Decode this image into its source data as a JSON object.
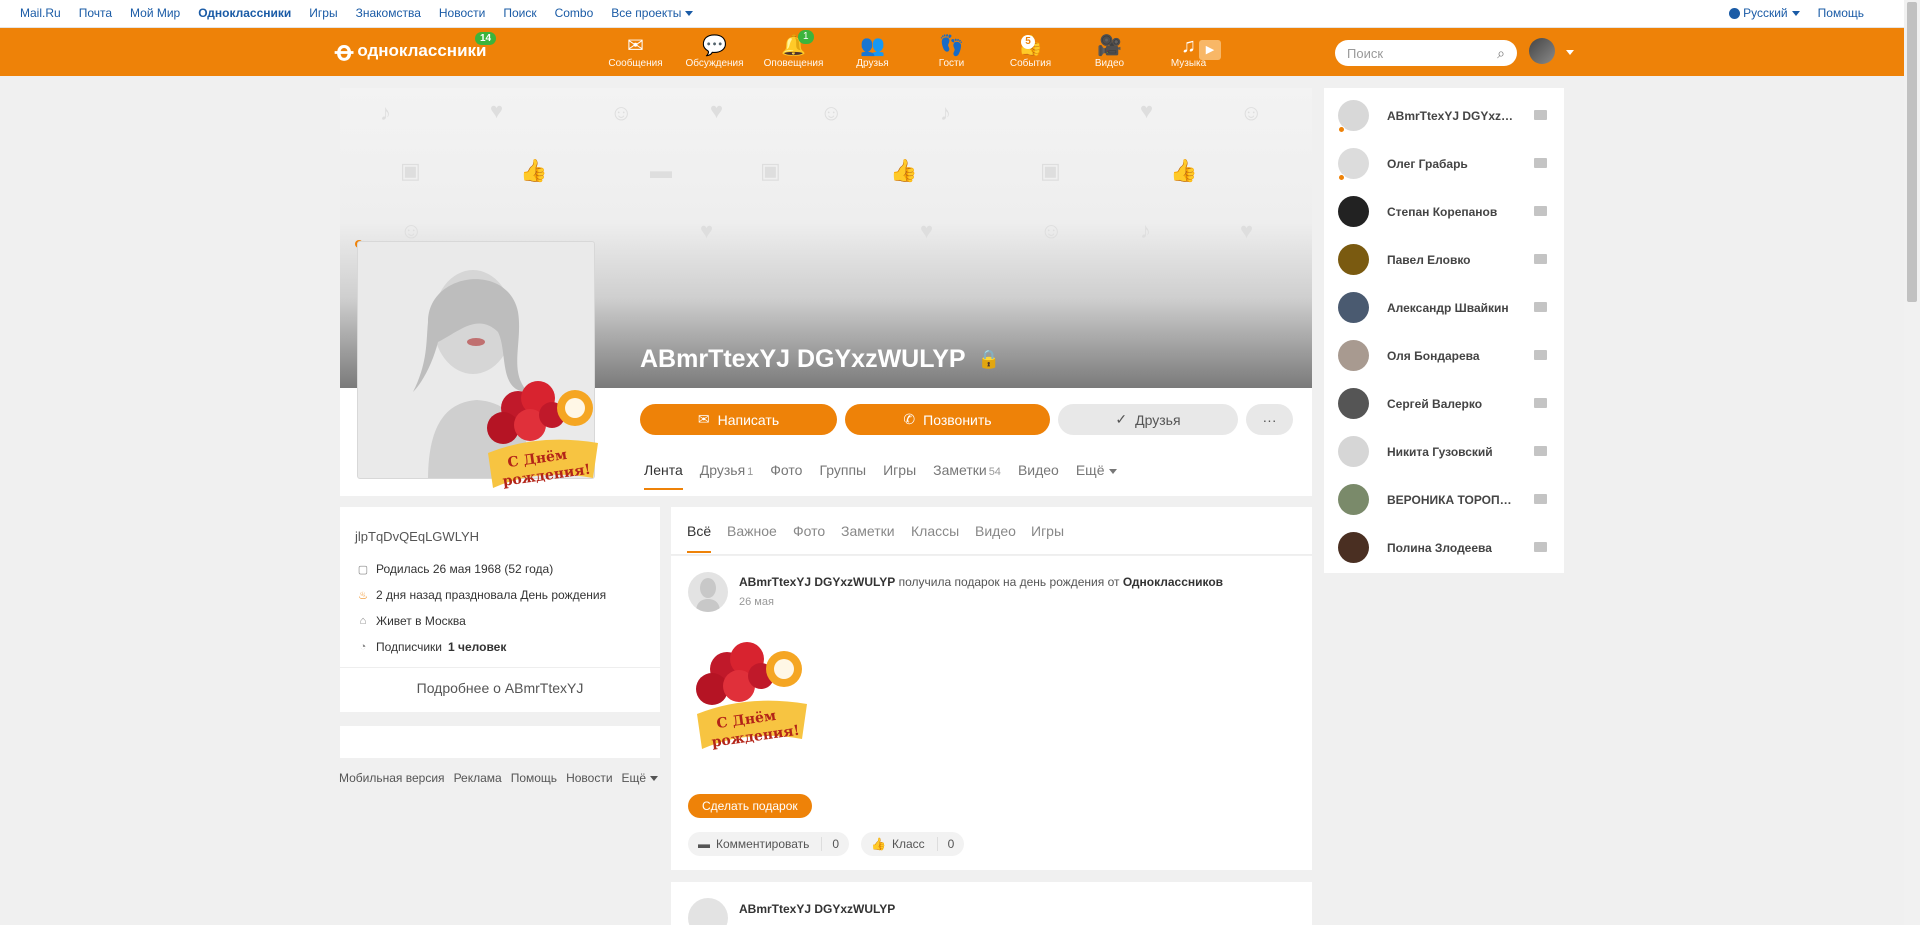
{
  "topbar": {
    "links": [
      "Mail.Ru",
      "Почта",
      "Мой Мир",
      "Одноклассники",
      "Игры",
      "Знакомства",
      "Новости",
      "Поиск",
      "Combo",
      "Все проекты"
    ],
    "language": "Русский",
    "help": "Помощь"
  },
  "header": {
    "logo_text": "одноклассники",
    "logo_badge": "14",
    "nav": [
      {
        "label": "Сообщения",
        "icon": "envelope-icon"
      },
      {
        "label": "Обсуждения",
        "icon": "chat-bubbles-icon"
      },
      {
        "label": "Оповещения",
        "icon": "bell-icon",
        "badge": "1"
      },
      {
        "label": "Друзья",
        "icon": "friends-icon"
      },
      {
        "label": "Гости",
        "icon": "footprints-icon"
      },
      {
        "label": "События",
        "icon": "events-icon",
        "badge": "5"
      },
      {
        "label": "Видео",
        "icon": "video-camera-icon"
      },
      {
        "label": "Музыка",
        "icon": "music-note-icon"
      }
    ],
    "search_placeholder": "Поиск"
  },
  "profile": {
    "name": "ABmrTtexYJ DGYxzWULYP",
    "buttons": {
      "write": "Написать",
      "call": "Позвонить",
      "friends": "Друзья",
      "more": "···"
    },
    "tabs": [
      {
        "label": "Лента",
        "count": ""
      },
      {
        "label": "Друзья",
        "count": "1"
      },
      {
        "label": "Фото",
        "count": ""
      },
      {
        "label": "Группы",
        "count": ""
      },
      {
        "label": "Игры",
        "count": ""
      },
      {
        "label": "Заметки",
        "count": "54"
      },
      {
        "label": "Видео",
        "count": ""
      },
      {
        "label": "Ещё",
        "count": ""
      }
    ],
    "gift_text_line1": "С Днём",
    "gift_text_line2": "рождения!"
  },
  "info": {
    "username": "jlpTqDvQEqLGWLYH",
    "born": "Родилась 26 мая 1968 (52 года)",
    "birthday": "2 дня назад праздновала День рождения",
    "lives": "Живет в Москва",
    "subs_label": "Подписчики",
    "subs_value": "1 человек",
    "more": "Подробнее о ABmrTtexYJ"
  },
  "footer": [
    "Мобильная версия",
    "Реклама",
    "Помощь",
    "Новости",
    "Ещё"
  ],
  "feed": {
    "tabs": [
      "Всё",
      "Важное",
      "Фото",
      "Заметки",
      "Классы",
      "Видео",
      "Игры"
    ],
    "post": {
      "author": "ABmrTtexYJ DGYxzWULYP",
      "action": " получила подарок на день рождения от ",
      "from": "Одноклассников",
      "date": "26 мая",
      "gift_button": "Сделать подарок",
      "comment_label": "Комментировать",
      "comment_count": "0",
      "like_label": "Класс",
      "like_count": "0"
    },
    "post2_author": "ABmrTtexYJ DGYxzWULYP"
  },
  "friends": [
    "ABmrTtexYJ DGYxzWULYP",
    "Олег Грабарь",
    "Степан Корепанов",
    "Павел Еловко",
    "Александр Швайкин",
    "Оля Бондарева",
    "Сергей Валерко",
    "Никита Гузовский",
    "ВЕРОНИКА ТОРОПОВА",
    "Полина Злодеева"
  ],
  "colors": {
    "brand": "#ee8208",
    "badge": "#3cb43c"
  }
}
